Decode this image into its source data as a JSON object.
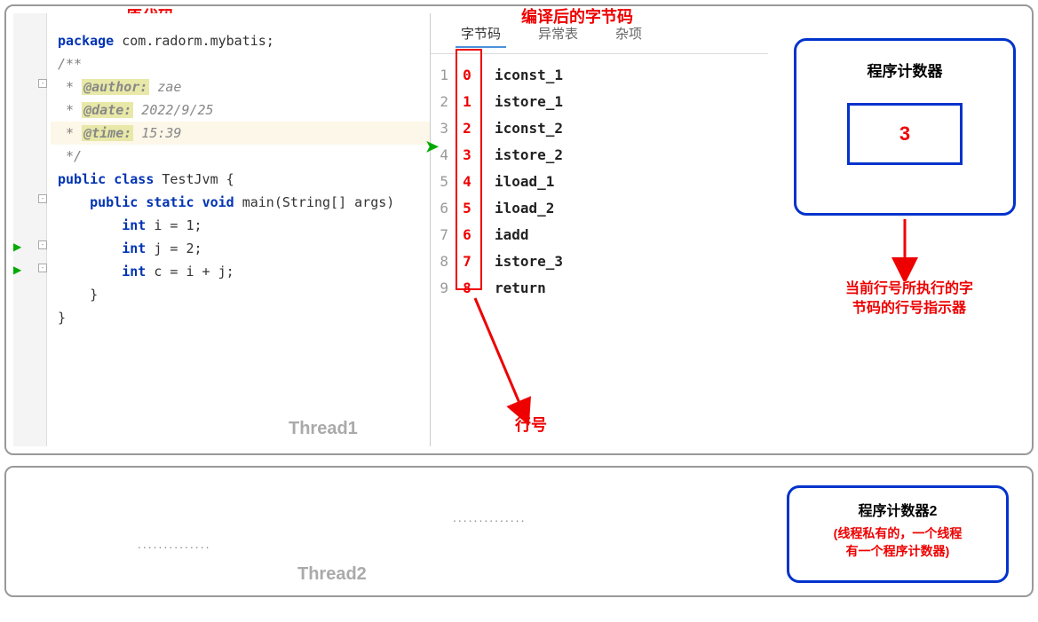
{
  "titles": {
    "source": "原代码",
    "bytecode": "编译后的字节码"
  },
  "source": {
    "l1_kw": "package",
    "l1_rest": " com.radorm.mybatis;",
    "l2": "",
    "l3": "/**",
    "l4_pre": " * ",
    "l4_tag": "@author:",
    "l4_val": " zae",
    "l5_pre": " * ",
    "l5_tag": "@date:",
    "l5_val": " 2022/9/25",
    "l6_pre": " * ",
    "l6_tag": "@time:",
    "l6_val": " 15:39",
    "l7": " */",
    "l8_kw1": "public",
    "l8_kw2": "class",
    "l8_rest": " TestJvm {",
    "l9_kw1": "public",
    "l9_kw2": "static",
    "l9_kw3": "void",
    "l9_rest": " main(String[] args)",
    "l10_kw": "int",
    "l10_rest": " i = 1;",
    "l11_kw": "int",
    "l11_rest": " j = 2;",
    "l12_kw": "int",
    "l12_rest": " c = i + j;",
    "l13": "    }",
    "l14": "}"
  },
  "thread1": "Thread1",
  "bytecode": {
    "tabs": {
      "t1": "字节码",
      "t2": "异常表",
      "t3": "杂项"
    },
    "rows": [
      {
        "ln": "1",
        "off": "0",
        "instr": "iconst_1"
      },
      {
        "ln": "2",
        "off": "1",
        "instr": "istore_1"
      },
      {
        "ln": "3",
        "off": "2",
        "instr": "iconst_2"
      },
      {
        "ln": "4",
        "off": "3",
        "instr": "istore_2"
      },
      {
        "ln": "5",
        "off": "4",
        "instr": "iload_1"
      },
      {
        "ln": "6",
        "off": "5",
        "instr": "iload_2"
      },
      {
        "ln": "7",
        "off": "6",
        "instr": "iadd"
      },
      {
        "ln": "8",
        "off": "7",
        "instr": "istore_3"
      },
      {
        "ln": "9",
        "off": "8",
        "instr": "return"
      }
    ],
    "lineno_label": "行号"
  },
  "pc": {
    "title": "程序计数器",
    "value": "3",
    "desc1": "当前行号所执行的字",
    "desc2": "节码的行号指示器"
  },
  "panel2": {
    "thread2": "Thread2",
    "dots": "..............",
    "pc2_title": "程序计数器2",
    "pc2_desc1": "(线程私有的，一个线程",
    "pc2_desc2": "有一个程序计数器)"
  }
}
